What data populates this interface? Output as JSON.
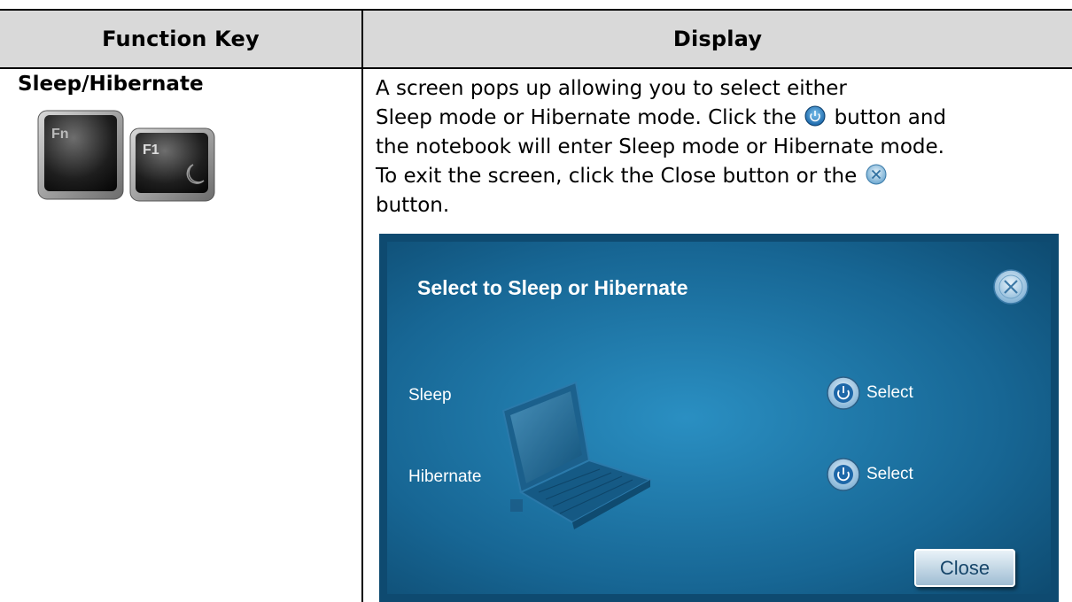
{
  "table": {
    "header": {
      "function_key": "Function Key",
      "display": "Display"
    },
    "row": {
      "key_name": "Sleep/Hibernate",
      "keys": {
        "fn_label": "Fn",
        "f1_label": "F1"
      },
      "description_lines": [
        "A screen pops up allowing you to select either",
        "Sleep mode or Hibernate mode.  Click the",
        "button and",
        "the notebook will enter Sleep mode or Hibernate mode.",
        "To exit the screen, click the Close button or the",
        "button."
      ]
    }
  },
  "dialog": {
    "title": "Select to Sleep or Hibernate",
    "sleep_label": "Sleep",
    "hibernate_label": "Hibernate",
    "select_label_1": "Select",
    "select_label_2": "Select",
    "close_label": "Close",
    "colors": {
      "background": "#1b6f9c",
      "frame": "#0f4f75",
      "accent": "#ffffff"
    }
  }
}
